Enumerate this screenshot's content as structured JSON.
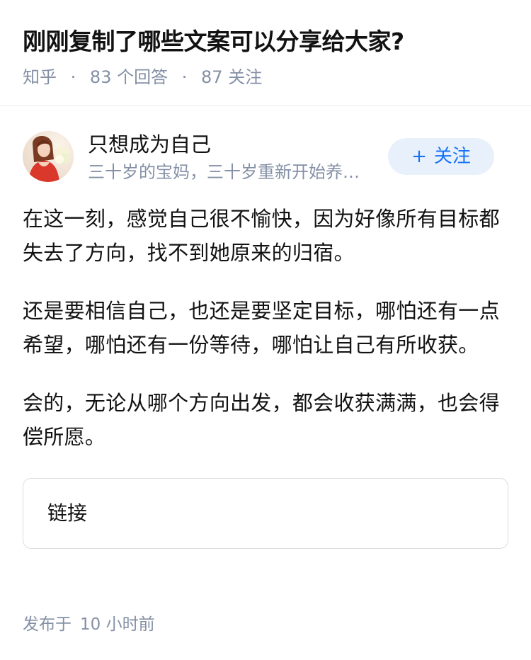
{
  "question": {
    "title": "刚刚复制了哪些文案可以分享给大家?",
    "source": "知乎",
    "answer_count": "83",
    "answer_label": "个回答",
    "follow_count": "87",
    "follow_label": "关注"
  },
  "author": {
    "name": "只想成为自己",
    "bio": "三十岁的宝妈，三十岁重新开始养…",
    "avatar_icon": "avatar-photo",
    "follow_button": "关注",
    "follow_button_icon": "plus-icon"
  },
  "answer": {
    "paragraphs": [
      "在这一刻，感觉自己很不愉快，因为好像所有目标都失去了方向，找不到她原来的归宿。",
      "还是要相信自己，也还是要坚定目标，哪怕还有一点希望，哪怕还有一份等待，哪怕让自己有所收获。",
      "会的，无论从哪个方向出发，都会收获满满，也会得偿所愿。"
    ],
    "link_card_label": "链接",
    "published_label": "发布于",
    "published_time": "10 小时前"
  },
  "colors": {
    "meta_gray": "#8590a6",
    "follow_bg": "#e8f1fb",
    "follow_text": "#1772f6"
  }
}
